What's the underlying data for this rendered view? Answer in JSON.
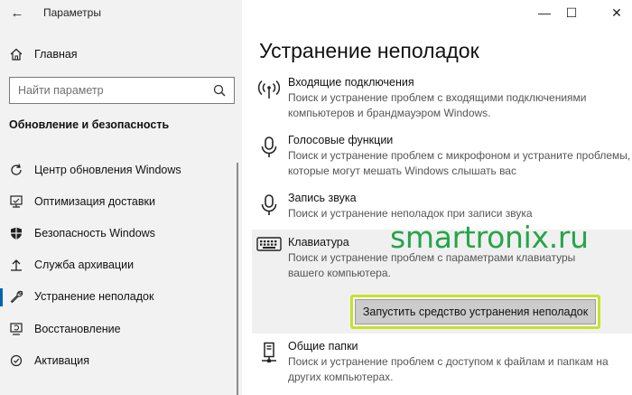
{
  "window": {
    "title": "Параметры",
    "controls": [
      "minimize-icon",
      "maximize-icon",
      "close-icon"
    ]
  },
  "sidebar": {
    "home_label": "Главная",
    "search_placeholder": "Найти параметр",
    "section_title": "Обновление и безопасность",
    "items": [
      {
        "label": "Центр обновления Windows",
        "icon": "refresh-icon"
      },
      {
        "label": "Оптимизация доставки",
        "icon": "delivery-icon"
      },
      {
        "label": "Безопасность Windows",
        "icon": "shield-icon"
      },
      {
        "label": "Служба архивации",
        "icon": "backup-icon"
      },
      {
        "label": "Устранение неполадок",
        "icon": "wrench-icon",
        "selected": true
      },
      {
        "label": "Восстановление",
        "icon": "recovery-icon"
      },
      {
        "label": "Активация",
        "icon": "activation-icon"
      }
    ]
  },
  "main": {
    "title": "Устранение неполадок",
    "items": [
      {
        "title": "Входящие подключения",
        "description": "Поиск и устранение проблем с входящими подключениями компьютеров и брандмауэром Windows.",
        "icon": "antenna-icon"
      },
      {
        "title": "Голосовые функции",
        "description": "Поиск и устранение проблем с микрофоном и устраните проблемы, которые могут мешать Windows слышать вас",
        "icon": "microphone-icon"
      },
      {
        "title": "Запись звука",
        "description": "Поиск и устранение неполадок при записи звука",
        "icon": "microphone-icon"
      },
      {
        "title": "Клавиатура",
        "description": "Поиск и устранение проблем с параметрами клавиатуры вашего компьютера.",
        "icon": "keyboard-icon",
        "selected": true
      },
      {
        "title": "Общие папки",
        "description": "Поиск и устранение проблем с доступом к файлам и папкам на других компьютерах.",
        "icon": "shared-folders-icon"
      }
    ],
    "run_button_label": "Запустить средство устранения неполадок"
  },
  "watermark": "smartronix.ru",
  "colors": {
    "accent": "#0063b1",
    "highlight_border": "#c7e12b",
    "watermark": "#25a54a"
  }
}
